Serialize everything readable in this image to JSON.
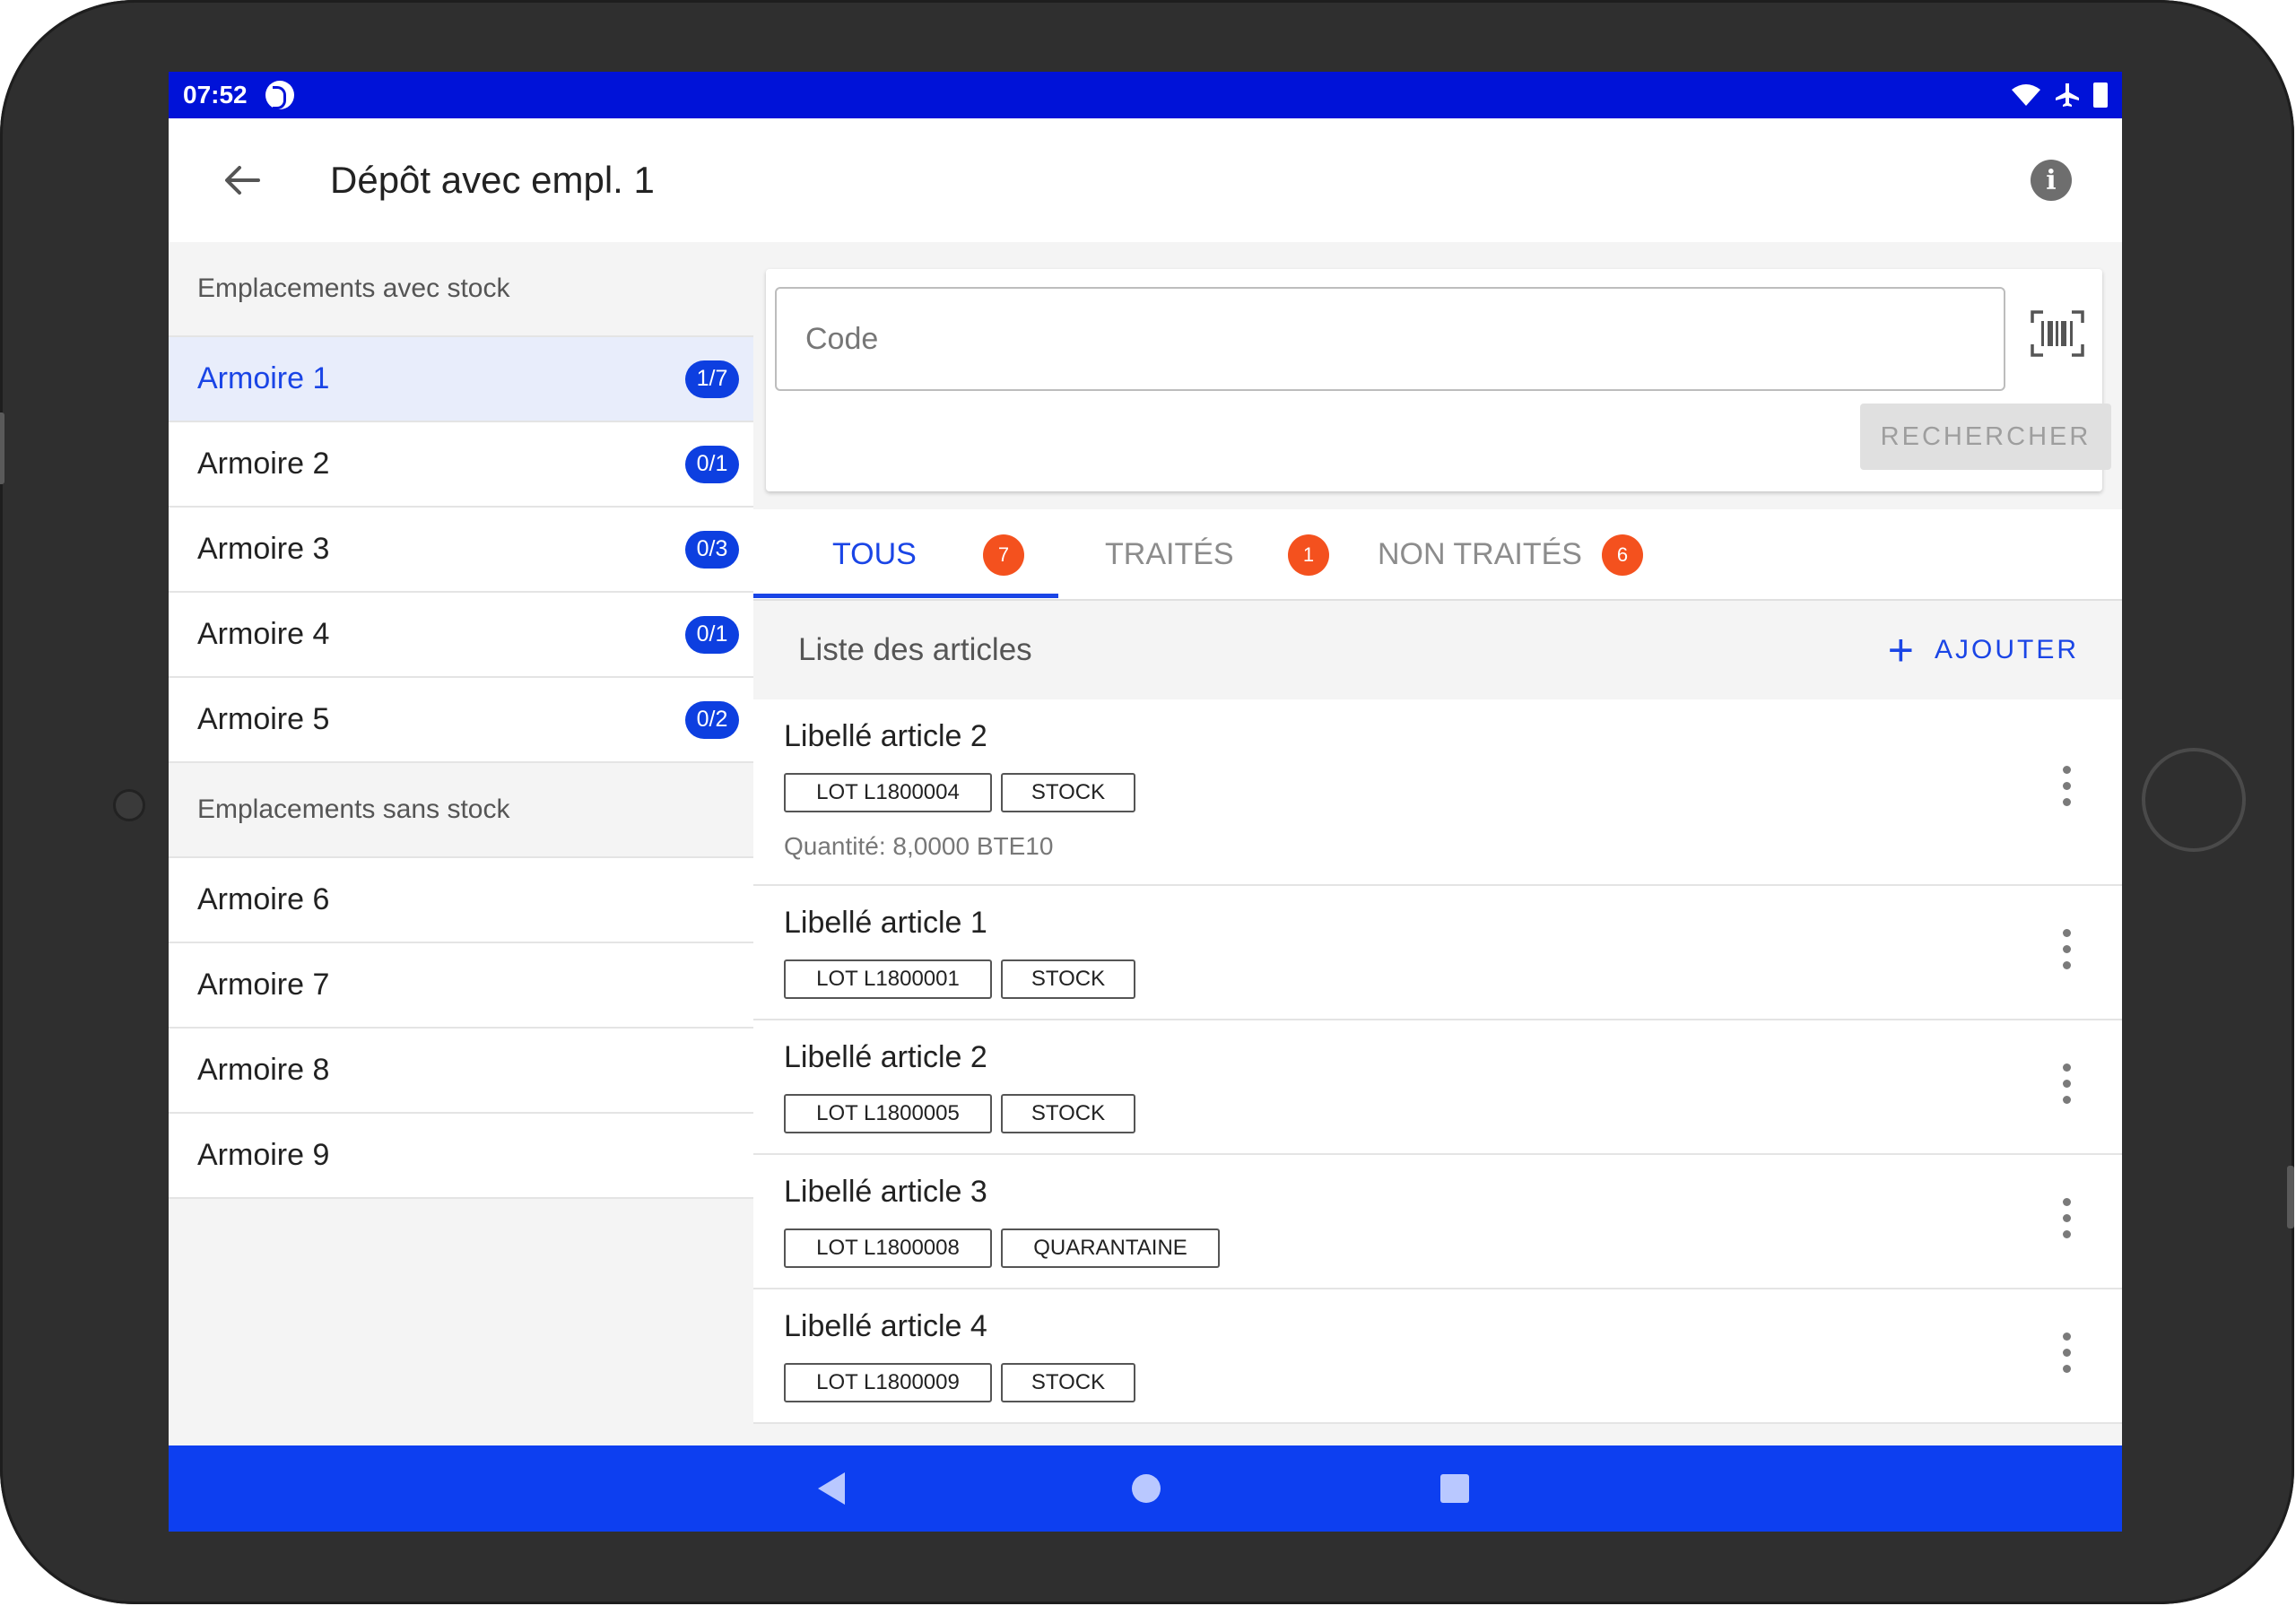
{
  "status_bar": {
    "time": "07:52"
  },
  "app_bar": {
    "title": "Dépôt avec empl. 1"
  },
  "left_panel": {
    "with_stock_header": "Emplacements avec stock",
    "with_stock": [
      {
        "label": "Armoire 1",
        "badge": "1/7",
        "selected": true
      },
      {
        "label": "Armoire 2",
        "badge": "0/1"
      },
      {
        "label": "Armoire 3",
        "badge": "0/3"
      },
      {
        "label": "Armoire 4",
        "badge": "0/1"
      },
      {
        "label": "Armoire 5",
        "badge": "0/2"
      }
    ],
    "without_stock_header": "Emplacements sans stock",
    "without_stock": [
      {
        "label": "Armoire 6"
      },
      {
        "label": "Armoire 7"
      },
      {
        "label": "Armoire 8"
      },
      {
        "label": "Armoire 9"
      }
    ]
  },
  "search": {
    "placeholder": "Code",
    "button_label": "RECHERCHER"
  },
  "tabs": [
    {
      "label": "TOUS",
      "count": "7",
      "active": true
    },
    {
      "label": "TRAITÉS",
      "count": "1"
    },
    {
      "label": "NON TRAITÉS",
      "count": "6"
    }
  ],
  "list": {
    "title": "Liste des articles",
    "add_label": "AJOUTER",
    "articles": [
      {
        "name": "Libellé article 2",
        "lot": "LOT L1800004",
        "status": "STOCK",
        "quantity": "Quantité: 8,0000 BTE10"
      },
      {
        "name": "Libellé article 1",
        "lot": "LOT L1800001",
        "status": "STOCK"
      },
      {
        "name": "Libellé article 2",
        "lot": "LOT L1800005",
        "status": "STOCK"
      },
      {
        "name": "Libellé article 3",
        "lot": "LOT L1800008",
        "status": "QUARANTAINE"
      },
      {
        "name": "Libellé article 4",
        "lot": "LOT L1800009",
        "status": "STOCK"
      }
    ]
  },
  "colors": {
    "status_bar": "#0012d8",
    "nav_bar": "#0d3ff0",
    "accent": "#1a45e6",
    "badge_blue": "#0d3fe0",
    "badge_orange": "#f4511e"
  },
  "icons": {
    "back": "arrow-left-icon",
    "info": "info-icon",
    "barcode": "barcode-scan-icon",
    "add": "plus-icon",
    "more": "more-vertical-icon"
  }
}
